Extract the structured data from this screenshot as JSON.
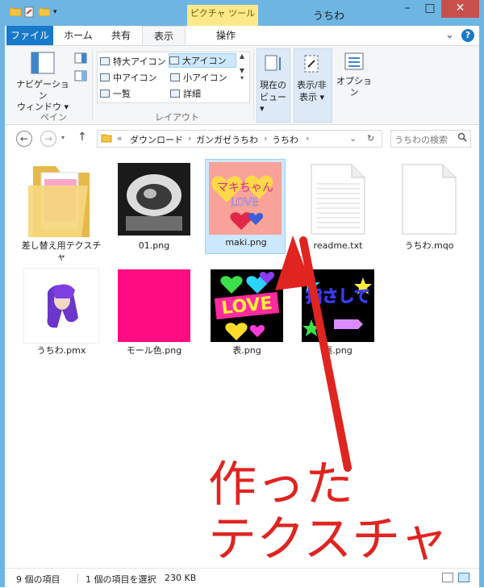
{
  "window": {
    "title": "うちわ",
    "context_tab": "ピクチャ ツール",
    "accent": "#6fb5e3"
  },
  "tabs": {
    "file": "ファイル",
    "home": "ホーム",
    "share": "共有",
    "view": "表示",
    "manage": "操作"
  },
  "ribbon": {
    "pane": {
      "nav_line1": "ナビゲーション",
      "nav_line2": "ウィンドウ ▾",
      "group": "ペイン"
    },
    "layout": {
      "items": [
        "特大アイコン",
        "大アイコン",
        "中アイコン",
        "小アイコン",
        "一覧",
        "詳細"
      ],
      "selected": "大アイコン",
      "group": "レイアウト"
    },
    "current_view": {
      "line1": "現在の",
      "line2": "ビュー ▾"
    },
    "show_hide": {
      "line1": "表示/非",
      "line2": "表示 ▾"
    },
    "options": "オプション"
  },
  "address": {
    "prefix": "«",
    "crumbs": [
      "ダウンロード",
      "ガンガゼうちわ",
      "うちわ"
    ],
    "search_placeholder": "うちわの検索"
  },
  "files": [
    {
      "name": "差し替え用テクスチャ",
      "name_line2": "ャ",
      "name_line1": "差し替え用テクスチ",
      "kind": "folder"
    },
    {
      "name": "01.png",
      "kind": "image-dark"
    },
    {
      "name": "maki.png",
      "kind": "image-maki",
      "selected": true,
      "art_text": "マキちゃん",
      "art_love": "LOVE"
    },
    {
      "name": "readme.txt",
      "kind": "text"
    },
    {
      "name": "うちわ.mqo",
      "kind": "blank"
    },
    {
      "name": "うちわ.pmx",
      "kind": "image-pmx"
    },
    {
      "name": "モール色.png",
      "kind": "image-magenta"
    },
    {
      "name": "表.png",
      "kind": "image-love",
      "art_text": "LOVE"
    },
    {
      "name": "裏.png",
      "kind": "image-sashite",
      "art_text": "指さして"
    }
  ],
  "overlay": {
    "line1": "作った",
    "line2": "テクスチャ",
    "color": "#e02420"
  },
  "status": {
    "count": "9 個の項目",
    "selection": "1 個の項目を選択",
    "size": "230 KB"
  }
}
